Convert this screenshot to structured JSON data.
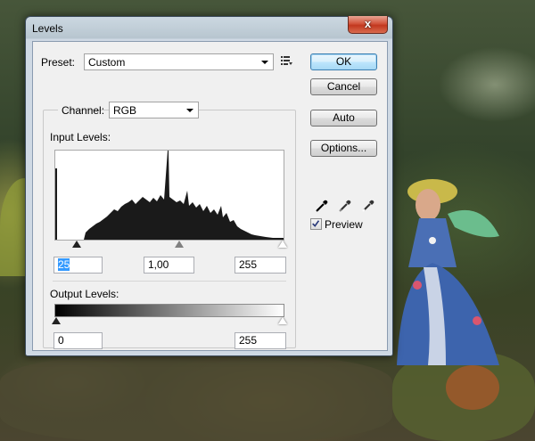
{
  "window": {
    "title": "Levels",
    "close_glyph": "x"
  },
  "preset": {
    "label": "Preset:",
    "value": "Custom"
  },
  "channel": {
    "label": "Channel:",
    "value": "RGB"
  },
  "input_levels": {
    "label": "Input Levels:",
    "black": "25",
    "gamma": "1,00",
    "white": "255"
  },
  "output_levels": {
    "label": "Output Levels:",
    "black": "0",
    "white": "255"
  },
  "buttons": {
    "ok": "OK",
    "cancel": "Cancel",
    "auto": "Auto",
    "options": "Options..."
  },
  "preview": {
    "label": "Preview",
    "checked": true
  },
  "icons": {
    "preset_menu": "preset-options-menu-icon",
    "eyedroppers": [
      "black-point-eyedropper-icon",
      "gray-point-eyedropper-icon",
      "white-point-eyedropper-icon"
    ]
  },
  "colors": {
    "primary_button_border": "#3c7fb1",
    "selection_highlight": "#3399ff",
    "close_button": "#c2381f"
  }
}
